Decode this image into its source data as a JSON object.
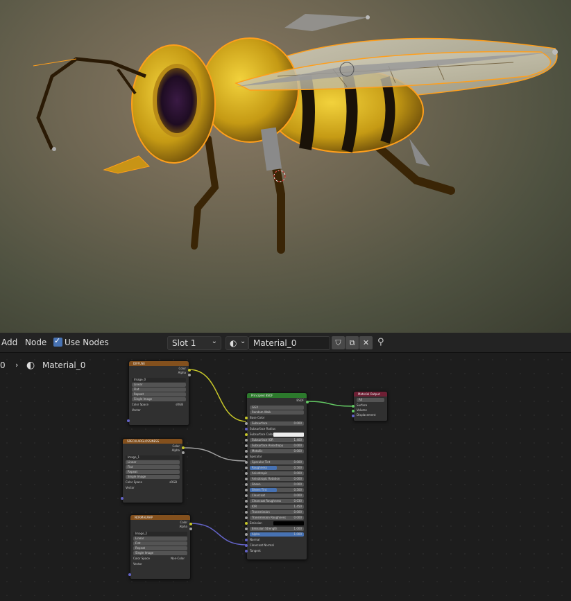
{
  "toolbar": {
    "add_label": "Add",
    "node_label": "Node",
    "use_nodes_label": "Use Nodes",
    "use_nodes_checked": true,
    "slot_value": "Slot 1",
    "material_name": "Material_0"
  },
  "breadcrumb": {
    "prefix": "0",
    "material": "Material_0"
  },
  "nodes": {
    "diffuse": {
      "title": "DIFFUSE",
      "outputs": [
        "Color",
        "Alpha"
      ],
      "image": "Image_0",
      "interpolation": "Linear",
      "projection": "Flat",
      "extension": "Repeat",
      "source": "Single Image",
      "colorspace_label": "Color Space",
      "colorspace_value": "sRGB",
      "vector": "Vector"
    },
    "specular": {
      "title": "SPECULARGLOSSINESS",
      "outputs": [
        "Color",
        "Alpha"
      ],
      "image": "Image_1",
      "interpolation": "Linear",
      "projection": "Flat",
      "extension": "Repeat",
      "source": "Single Image",
      "colorspace_label": "Color Space",
      "colorspace_value": "sRGB",
      "vector": "Vector"
    },
    "normal": {
      "title": "NORMALMAP",
      "outputs": [
        "Color",
        "Alpha"
      ],
      "image": "Image_2",
      "interpolation": "Linear",
      "projection": "Flat",
      "extension": "Repeat",
      "source": "Single Image",
      "colorspace_label": "Color Space",
      "colorspace_value": "Non-Color",
      "vector": "Vector"
    },
    "principled": {
      "title": "Principled BSDF",
      "output": "BSDF",
      "distribution": "GGX",
      "subsurface_method": "Random Walk",
      "inputs": [
        {
          "label": "Base Color",
          "value": ""
        },
        {
          "label": "Subsurface",
          "value": "0.000"
        },
        {
          "label": "Subsurface Radius",
          "value": ""
        },
        {
          "label": "Subsurface Color",
          "value": ""
        },
        {
          "label": "Subsurface IOR",
          "value": "1.400"
        },
        {
          "label": "Subsurface Anisotropy",
          "value": "0.000"
        },
        {
          "label": "Metallic",
          "value": "0.000"
        },
        {
          "label": "Specular",
          "value": ""
        },
        {
          "label": "Specular Tint",
          "value": "0.000"
        },
        {
          "label": "Roughness",
          "value": "0.500"
        },
        {
          "label": "Anisotropic",
          "value": "0.000"
        },
        {
          "label": "Anisotropic Rotation",
          "value": "0.000"
        },
        {
          "label": "Sheen",
          "value": "0.000"
        },
        {
          "label": "Sheen Tint",
          "value": "0.500"
        },
        {
          "label": "Clearcoat",
          "value": "0.000"
        },
        {
          "label": "Clearcoat Roughness",
          "value": "0.030"
        },
        {
          "label": "IOR",
          "value": "1.450"
        },
        {
          "label": "Transmission",
          "value": "0.000"
        },
        {
          "label": "Transmission Roughness",
          "value": "0.000"
        },
        {
          "label": "Emission",
          "value": ""
        },
        {
          "label": "Emission Strength",
          "value": "1.000"
        },
        {
          "label": "Alpha",
          "value": "1.000"
        },
        {
          "label": "Normal",
          "value": ""
        },
        {
          "label": "Clearcoat Normal",
          "value": ""
        },
        {
          "label": "Tangent",
          "value": ""
        }
      ]
    },
    "output": {
      "title": "Material Output",
      "target": "All",
      "inputs": [
        "Surface",
        "Volume",
        "Displacement"
      ]
    }
  },
  "colors": {
    "image_header": "#83501d",
    "shader_header": "#2c7a2c",
    "output_header": "#6e1f34",
    "accent": "#4772b3",
    "selection": "#ff9f1c"
  }
}
